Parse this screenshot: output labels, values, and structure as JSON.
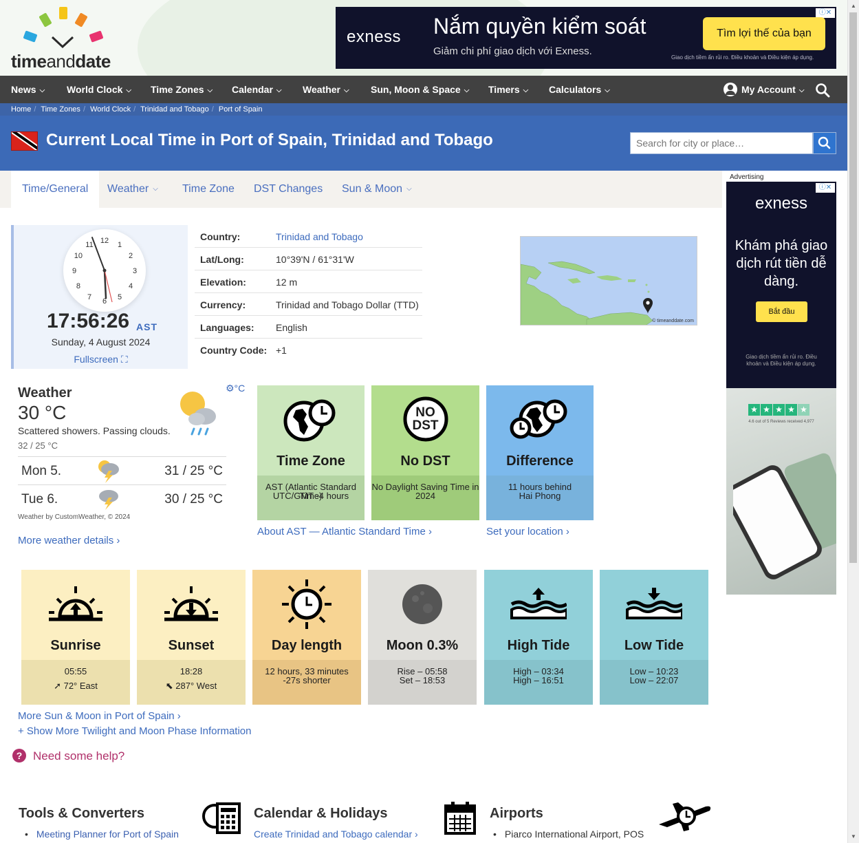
{
  "header": {
    "logo_text_time": "time",
    "logo_text_and": "and",
    "logo_text_date": "date"
  },
  "top_ad": {
    "brand": "exness",
    "headline": "Nắm quyền kiểm soát",
    "subline": "Giảm chi phí giao dịch với Exness.",
    "cta": "Tìm lợi thế của bạn",
    "fine_print": "Giao dịch tiềm ẩn rủi ro. Điều khoản và Điều kiện áp dụng.",
    "adchoice": "ⓘ✕"
  },
  "nav": {
    "items": [
      "News",
      "World Clock",
      "Time Zones",
      "Calendar",
      "Weather",
      "Sun, Moon & Space",
      "Timers",
      "Calculators"
    ],
    "account": "My Account"
  },
  "breadcrumb": [
    "Home",
    "Time Zones",
    "World Clock",
    "Trinidad and Tobago",
    "Port of Spain"
  ],
  "page_title": "Current Local Time in Port of Spain, Trinidad and Tobago",
  "search": {
    "placeholder": "Search for city or place…"
  },
  "tabs": [
    "Time/General",
    "Weather",
    "Time Zone",
    "DST Changes",
    "Sun & Moon"
  ],
  "clock": {
    "time": "17:56:26",
    "tz": "AST",
    "date": "Sunday, 4 August 2024",
    "fullscreen": "Fullscreen ⛶",
    "numbers": [
      "12",
      "1",
      "2",
      "3",
      "4",
      "5",
      "6",
      "7",
      "8",
      "9",
      "10",
      "11"
    ]
  },
  "info": [
    {
      "key": "Country:",
      "value": "Trinidad and Tobago"
    },
    {
      "key": "Lat/Long:",
      "value": "10°39'N / 61°31'W"
    },
    {
      "key": "Elevation:",
      "value": "12 m"
    },
    {
      "key": "Currency:",
      "value": "Trinidad and Tobago Dollar (TTD)"
    },
    {
      "key": "Languages:",
      "value": "English"
    },
    {
      "key": "Country Code:",
      "value": "+1"
    }
  ],
  "map": {
    "credit": "© timeanddate.com"
  },
  "weather": {
    "title": "Weather",
    "temp": "30 °C",
    "desc": "Scattered showers. Passing clouds.",
    "hilo": "32 / 25 °C",
    "unit": "⚙°C",
    "forecast": [
      {
        "day": "Mon 5.",
        "temp": "31 / 25 °C"
      },
      {
        "day": "Tue 6.",
        "temp": "30 / 25 °C"
      }
    ],
    "credit": "Weather by CustomWeather, © 2024",
    "more": "More weather details ›"
  },
  "tiles": {
    "timezone": {
      "label": "Time Zone",
      "line1": "AST (Atlantic Standard Time)",
      "line2": "UTC/GMT -4 hours"
    },
    "dst": {
      "label": "No DST",
      "icon_top": "NO",
      "icon_bottom": "DST",
      "line1": "No Daylight Saving Time in",
      "line2": "2024"
    },
    "difference": {
      "label": "Difference",
      "line1": "11 hours behind",
      "line2": "Hai Phong"
    },
    "about_ast": "About AST — Atlantic Standard Time ›",
    "set_location": "Set your location ›"
  },
  "sun_tiles": [
    {
      "label": "Sunrise",
      "line1": "05:55",
      "line2": "➚ 72° East"
    },
    {
      "label": "Sunset",
      "line1": "18:28",
      "line2": "⬉ 287° West"
    },
    {
      "label": "Day length",
      "line1": "12 hours, 33 minutes",
      "line2": "-27s shorter"
    },
    {
      "label": "Moon 0.3%",
      "line1": "Rise – 05:58",
      "line2": "Set – 18:53"
    },
    {
      "label": "High Tide",
      "line1": "High – 03:34",
      "line2": "High – 16:51"
    },
    {
      "label": "Low Tide",
      "line1": "Low – 10:23",
      "line2": "Low – 22:07"
    }
  ],
  "more_sunmoon": "More Sun & Moon in Port of Spain ›",
  "show_twilight": "+ Show More Twilight and Moon Phase Information",
  "help": "Need some help?",
  "footer": {
    "tools_title": "Tools & Converters",
    "tools_item": "Meeting Planner for Port of Spain",
    "calendar_title": "Calendar & Holidays",
    "calendar_link": "Create Trinidad and Tobago calendar ›",
    "airports_title": "Airports",
    "airports_item": "Piarco International Airport, POS"
  },
  "side_ad": {
    "label": "Advertising",
    "brand": "exness",
    "headline": "Khám phá giao dịch rút tiền dễ dàng.",
    "cta": "Bắt đầu",
    "fine_print": "Giao dịch tiềm ẩn rủi ro. Điều khoản và Điều kiện áp dụng.",
    "rating": "4.6 out of 5 Reviews received 4,977"
  },
  "colors": {
    "nav_bg": "#414141",
    "title_band": "#3c6ab7",
    "link": "#3d6bbd",
    "tz_tile": "#cce7bd",
    "dst_tile": "#b3dd8d",
    "diff_tile": "#7cb9ec",
    "sunrise_tile": "#fcefc2",
    "day_tile": "#f7d493",
    "moon_tile": "#e0dfdb",
    "tide_tile": "#91d0d9"
  }
}
